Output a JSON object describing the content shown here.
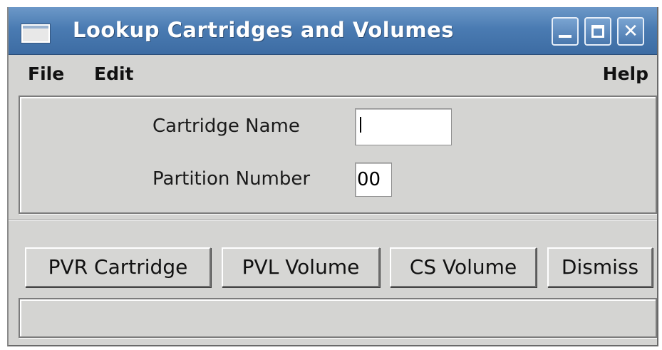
{
  "window": {
    "title": "Lookup Cartridges and Volumes",
    "controls": {
      "minimize_icon": "minimize-icon",
      "maximize_icon": "maximize-icon",
      "close_icon": "close-icon"
    }
  },
  "menubar": {
    "file_label": "File",
    "edit_label": "Edit",
    "help_label": "Help"
  },
  "form": {
    "cartridge_name": {
      "label": "Cartridge Name",
      "value": ""
    },
    "partition_number": {
      "label": "Partition Number",
      "value": "00"
    }
  },
  "actions": {
    "pvr_cartridge_label": "PVR Cartridge",
    "pvl_volume_label": "PVL Volume",
    "cs_volume_label": "CS Volume",
    "dismiss_label": "Dismiss"
  },
  "status": {
    "message": ""
  },
  "colors": {
    "titlebar": "#4a7bb2",
    "window_background": "#d4d4d2",
    "title_text": "#ffffff"
  }
}
